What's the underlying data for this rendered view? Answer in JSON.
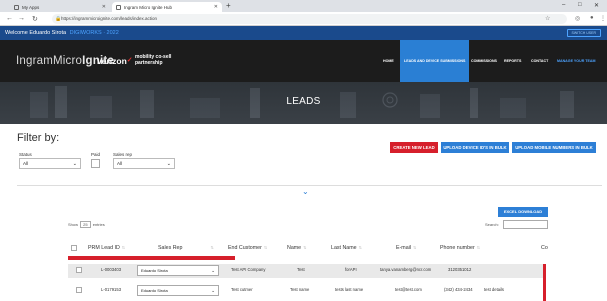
{
  "browser": {
    "tabs": [
      {
        "label": "My Apps"
      },
      {
        "label": "Ingram Micro Ignite Hub"
      }
    ],
    "new_tab": "+",
    "url": "https://ingrammicroignite.com/leads/index.action",
    "window_controls": [
      "–",
      "□",
      "✕"
    ]
  },
  "topbar": {
    "welcome": "Welcome Eduardo Sirota",
    "program": "DIGIWORKS · 2022",
    "button": "SWITCH USER"
  },
  "header": {
    "brand_ingram": "IngramMicro",
    "brand_ignite": "Ignite",
    "partner": "verizon",
    "tagline_1": "mobility co-sell",
    "tagline_2": "partnership",
    "nav": [
      "HOME",
      "LEADS AND DEVICE SUBMISSIONS",
      "COMMISSIONS",
      "REPORTS",
      "CONTACT",
      "MANAGE YOUR TEAM"
    ]
  },
  "banner": {
    "title": "LEADS"
  },
  "filters": {
    "heading": "Filter by:",
    "status_label": "Status",
    "status_value": "All",
    "paid_label": "Paid",
    "salesrep_label": "Sales rep",
    "salesrep_value": "All"
  },
  "actions": {
    "create_lead": "CREATE NEW LEAD",
    "upload_devices": "UPLOAD DEVICE ID'S IN BULK",
    "upload_mobile": "UPLOAD MOBILE NUMBERS IN BULK"
  },
  "table_controls": {
    "excel": "EXCEL DOWNLOAD",
    "show": "Show",
    "show_value": "25",
    "entries": "entries",
    "search": "Search:"
  },
  "table": {
    "headers": [
      "PRM Lead ID",
      "Sales Rep",
      "End Customer",
      "Name",
      "Last Name",
      "E-mail",
      "Phone number",
      "Co"
    ],
    "rows": [
      {
        "id": "L-0003403",
        "rep": "Eduardo Sirota",
        "customer": "Test API Company",
        "name": "Test",
        "last": "forAPI",
        "email": "tanya.vanamberg@ncr.com",
        "phone": "3120351012",
        "co": ""
      },
      {
        "id": "L-0179153",
        "rep": "Eduardo Sirota",
        "customer": "Test cutmer",
        "name": "Test name",
        "last": "tests last name",
        "email": "test@test.com",
        "phone": "(342) 434-2434",
        "co": "test details"
      }
    ]
  },
  "colors": {
    "topbar": "#1a4a8c",
    "header": "#1c1c1c",
    "accent_blue": "#2d7fd6",
    "accent_red": "#d61f2b"
  }
}
